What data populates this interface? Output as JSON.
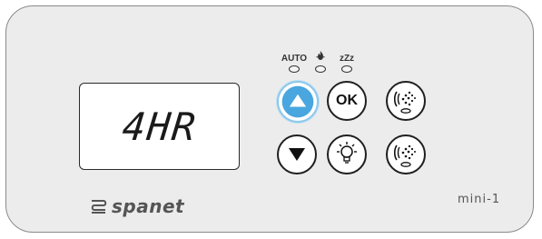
{
  "display": {
    "text": "4HR"
  },
  "indicators": [
    {
      "label": "AUTO",
      "icon": "auto-mode",
      "lit": false
    },
    {
      "label": "",
      "icon": "heat-flame-icon",
      "lit": false
    },
    {
      "label": "zZz",
      "icon": "sleep-mode",
      "lit": false
    }
  ],
  "buttons": {
    "up": {
      "icon": "triangle-up-icon",
      "active": true,
      "color": "#4aa6de"
    },
    "down": {
      "icon": "triangle-down-icon"
    },
    "ok": {
      "label": "OK"
    },
    "light": {
      "icon": "light-bulb-icon"
    },
    "jet1": {
      "icon": "jet-pump-icon"
    },
    "jet2": {
      "icon": "jet-pump-icon"
    }
  },
  "brand": {
    "name": "spanet"
  },
  "model": {
    "name": "mini-1"
  },
  "colors": {
    "panel": "#ececec",
    "outline": "#1f1f1f",
    "accent": "#4aa6de",
    "text": "#555555"
  }
}
